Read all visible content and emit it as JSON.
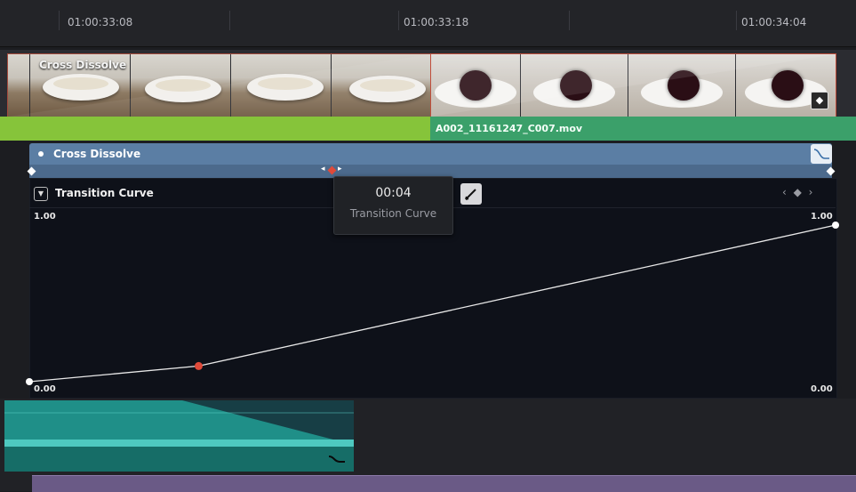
{
  "ruler": {
    "timecodes": [
      "01:00:33:08",
      "01:00:33:18",
      "01:00:34:04"
    ]
  },
  "video_clip": {
    "transition_label": "Cross Dissolve",
    "clip_name": "A002_11161247_C007.mov",
    "keyframe_icon": "keyframe-diamond-icon"
  },
  "transition": {
    "title": "Cross Dissolve",
    "curve_icon": "transition-curve-icon"
  },
  "curve_editor": {
    "title": "Transition Curve",
    "y_top_left": "1.00",
    "y_top_right": "1.00",
    "y_bottom_left": "0.00",
    "y_bottom_right": "0.00",
    "nav": "‹ ◆ ›",
    "curve_points": [
      {
        "t": 0.0,
        "v": 0.0
      },
      {
        "t": 0.21,
        "v": 0.1
      },
      {
        "t": 1.0,
        "v": 1.0
      }
    ],
    "selected_point_color": "#e04a3a",
    "line_color": "#e8e8e8"
  },
  "tooltip": {
    "time": "00:04",
    "label": "Transition Curve"
  },
  "audio": {
    "icon": "transition-curve-icon",
    "clip_color": "#1f8f88"
  },
  "colors": {
    "green_clip": "#86c43a",
    "teal_clip": "#3ba06a",
    "transition_blue": "#5b7ea4",
    "purple_clip": "#6a5a86"
  }
}
